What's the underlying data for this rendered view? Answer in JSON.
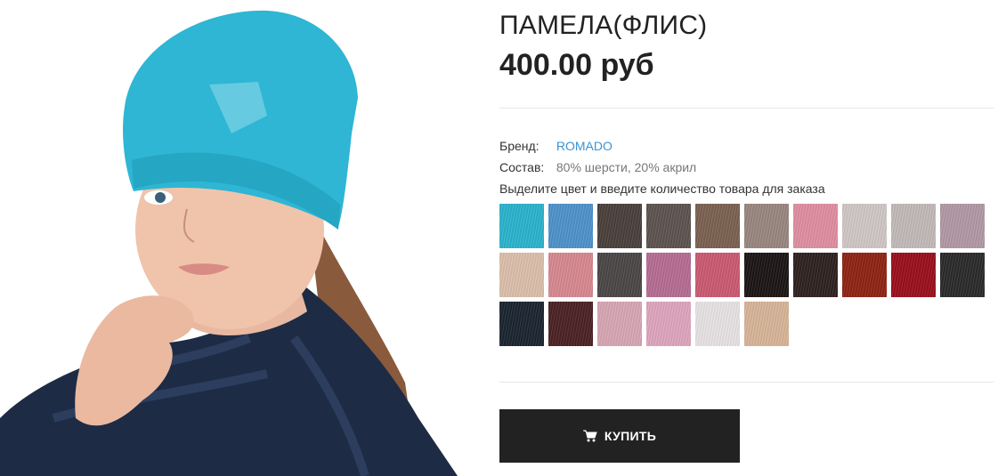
{
  "product": {
    "title": "ПАМЕЛА(ФЛИС)",
    "price": "400.00 руб",
    "image_alt": "Model wearing a turquoise knit beanie and navy puffer jacket"
  },
  "details": {
    "brand_label": "Бренд:",
    "brand_value": "ROMADO",
    "composition_label": "Состав:",
    "composition_value": "80% шерсти, 20% акрил",
    "color_hint": "Выделите цвет и введите количество товара для заказа"
  },
  "colors": {
    "link": "#3a93d6",
    "button_bg": "#222222",
    "swatches": [
      "#2bb5cf",
      "#4f93cc",
      "#4a403c",
      "#5e5450",
      "#7c6251",
      "#9a8880",
      "#e18fa2",
      "#d1c9c7",
      "#c4bbba",
      "#b39aa6",
      "#dcc0ac",
      "#d98991",
      "#4b4747",
      "#b76d93",
      "#cc5a72",
      "#1b1615",
      "#2f2220",
      "#8f2413",
      "#9b0f1c",
      "#2b2b2b",
      "#1b2530",
      "#4b2224",
      "#d9a7b5",
      "#e0a7bf",
      "#e9e3e4",
      "#d9b699"
    ]
  },
  "actions": {
    "buy_label": "КУПИТЬ"
  }
}
